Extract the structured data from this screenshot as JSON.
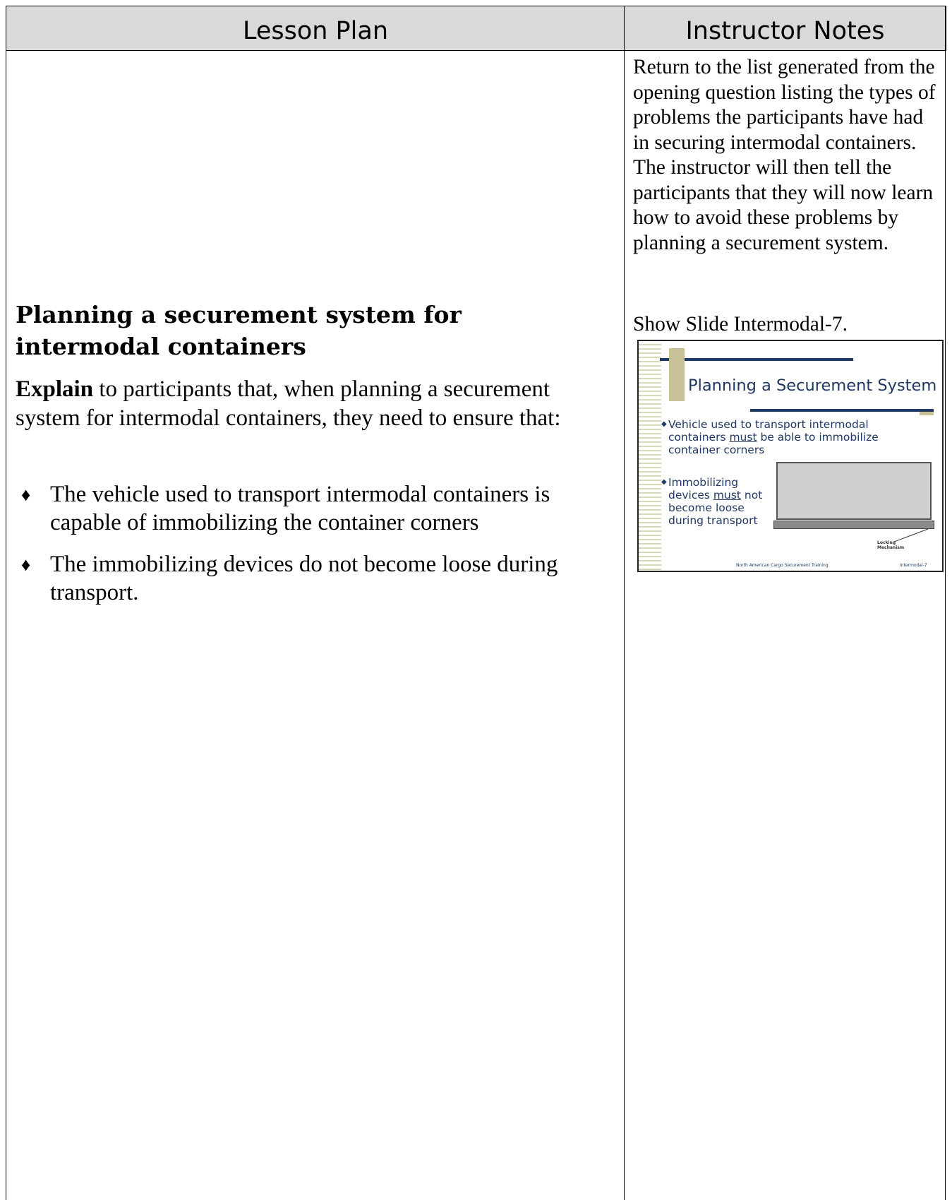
{
  "header": {
    "left_title": "Lesson Plan",
    "right_title": "Instructor Notes"
  },
  "notes": {
    "paragraph": "Return to the list generated from the opening question listing the types of problems the participants have had in securing intermodal containers.  The instructor will then tell the participants that they will now learn how to avoid these problems by planning a securement system.",
    "slide_reference": "Show Slide Intermodal-7."
  },
  "lesson": {
    "section_title": "Planning a securement system for intermodal containers",
    "explain_bold": "Explain",
    "explain_rest": " to participants that, when planning a securement system for intermodal containers, they need to ensure that:",
    "bullet_symbol": "♦",
    "bullets": [
      "The vehicle used to transport intermodal containers is capable of immobilizing the container corners",
      "The immobilizing devices do not become loose during transport."
    ]
  },
  "slide": {
    "title": "Planning a Securement System",
    "bullet1_a": "Vehicle used to transport intermodal containers ",
    "bullet1_must": "must",
    "bullet1_b": " be able to immobilize container corners",
    "bullet2_a": "Immobilizing devices ",
    "bullet2_must": "must",
    "bullet2_b": " not become loose during transport",
    "lock_label_1": "Locking",
    "lock_label_2": "Mechanism",
    "footer_left": "North American Cargo Securement Training",
    "footer_right": "Intermodal-7",
    "colors": {
      "title": "#1f3864",
      "accent": "#c8c196",
      "container": "#cfcfcf"
    }
  }
}
